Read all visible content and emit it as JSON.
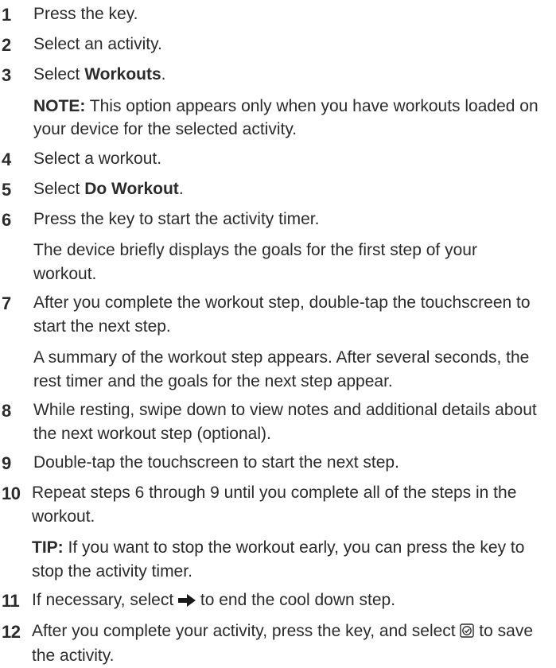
{
  "steps": [
    {
      "number": "1",
      "text": "Press the key."
    },
    {
      "number": "2",
      "text": "Select an activity."
    },
    {
      "number": "3",
      "pre": "Select ",
      "bold": "Workouts",
      "post": ".",
      "note_label": "NOTE:",
      "note_text": " This option appears only when you have workouts loaded on your device for the selected activity."
    },
    {
      "number": "4",
      "text": "Select a workout."
    },
    {
      "number": "5",
      "pre": "Select ",
      "bold": "Do Workout",
      "post": "."
    },
    {
      "number": "6",
      "text": "Press the key to start the activity timer.",
      "detail": "The device briefly displays the goals for the first step of your workout."
    },
    {
      "number": "7",
      "text": "After you complete the workout step, double-tap the touchscreen to start the next step.",
      "detail": "A summary of the workout step appears. After several seconds, the rest timer and the goals for the next step appear."
    },
    {
      "number": "8",
      "text": "While resting, swipe down to view notes and additional details about the next workout step (optional)."
    },
    {
      "number": "9",
      "text": "Double-tap the touchscreen to start the next step."
    },
    {
      "number": "10",
      "text": "Repeat steps 6 through 9 until you complete all of the steps in the workout.",
      "tip_label": "TIP:",
      "tip_text": " If you want to stop the workout early, you can press the key to stop the activity timer."
    },
    {
      "number": "11",
      "pre": "If necessary, select ",
      "icon": "right-arrow-icon",
      "post": " to end the cool down step."
    },
    {
      "number": "12",
      "pre": "After you complete your activity, press the key, and select ",
      "icon": "save-check-icon",
      "post": " to save the activity."
    }
  ]
}
